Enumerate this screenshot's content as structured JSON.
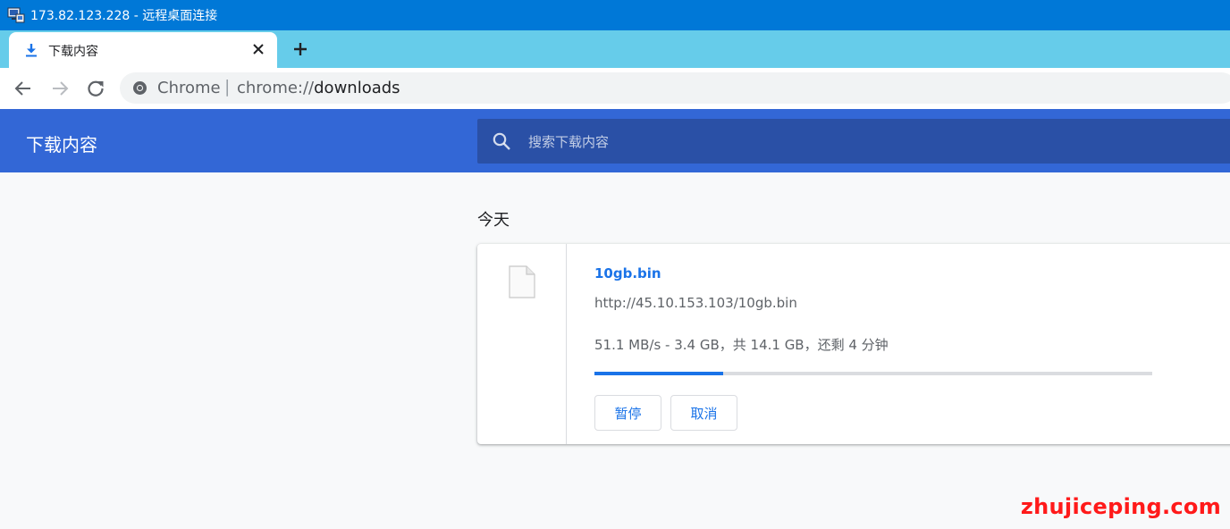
{
  "window": {
    "title": "173.82.123.228 - 远程桌面连接",
    "icon": "remote-desktop-icon"
  },
  "tab": {
    "title": "下载内容",
    "icon": "download-icon",
    "close_icon": "close-icon",
    "new_tab_icon": "plus-icon"
  },
  "toolbar": {
    "back_icon": "back-arrow-icon",
    "forward_icon": "forward-arrow-icon",
    "reload_icon": "reload-icon",
    "omnibox": {
      "origin_label": "Chrome",
      "separator": "|",
      "url_scheme": "chrome://",
      "url_path": "downloads"
    }
  },
  "downloads": {
    "header_title": "下载内容",
    "search_placeholder": "搜索下载内容",
    "section": "今天",
    "items": [
      {
        "file_name": "10gb.bin",
        "url": "http://45.10.153.103/10gb.bin",
        "status": "51.1 MB/s - 3.4 GB，共 14.1 GB，还剩 4 分钟",
        "progress_fraction": 0.23,
        "pause_label": "暂停",
        "cancel_label": "取消"
      }
    ]
  },
  "watermark": "zhujiceping.com",
  "colors": {
    "titlebar": "#0078d7",
    "tabstrip": "#66ccea",
    "header": "#3367d6",
    "search": "#2a50a6",
    "accent": "#1a73e8",
    "watermark": "#ff1a1a"
  }
}
